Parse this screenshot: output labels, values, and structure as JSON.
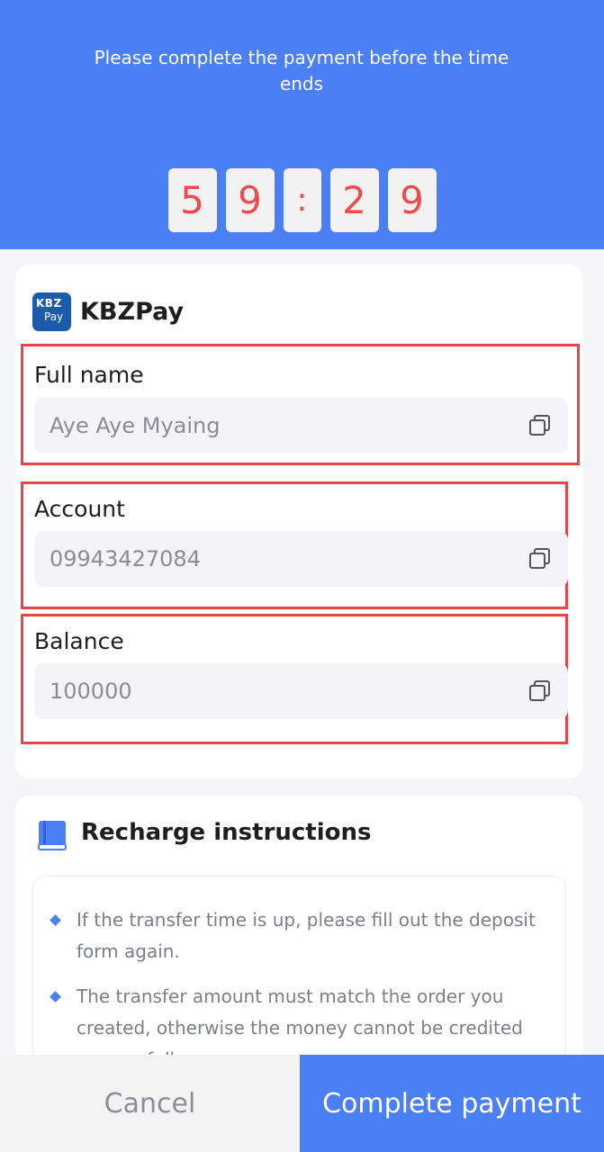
{
  "header": {
    "message": "Please complete the payment before the time ends",
    "timer": [
      "5",
      "9",
      ":",
      "2",
      "9"
    ]
  },
  "payment": {
    "logo_line1": "KBZ",
    "logo_line2": "Pay",
    "method_name": "KBZPay",
    "fields": [
      {
        "label": "Full name",
        "value": "Aye Aye Myaing"
      },
      {
        "label": "Account",
        "value": "09943427084"
      },
      {
        "label": "Balance",
        "value": "100000"
      }
    ]
  },
  "instructions": {
    "title": "Recharge instructions",
    "items": [
      "If the transfer time is up, please fill out the deposit form again.",
      "The transfer amount must match the order you created, otherwise the money cannot be credited successfully."
    ]
  },
  "actions": {
    "cancel_label": "Cancel",
    "complete_label": "Complete payment"
  },
  "colors": {
    "accent": "#4b7ff5",
    "timer_digit": "#ef4b4b",
    "highlight_border": "#e8444a"
  }
}
